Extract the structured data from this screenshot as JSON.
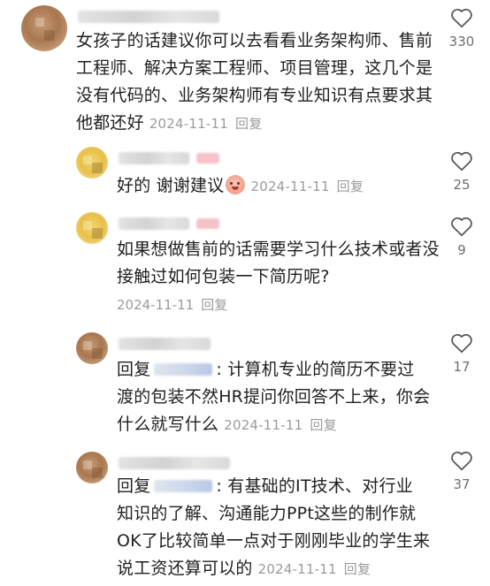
{
  "comments": [
    {
      "lines": [
        "女孩子的话建议你可以去看看业务架构师、售前",
        "工程师、解决方案工程师、项目管理，这几个是",
        "没有代码的、业务架构师有专业知识有点要求其",
        "他都还好"
      ],
      "date": "2024-11-11",
      "reply_label": "回复",
      "likes": "330",
      "heart_icon": "heart-outline-icon"
    },
    {
      "text": "好的 谢谢建议",
      "emoji_icon": "pig-face-emoji-icon",
      "date": "2024-11-11",
      "reply_label": "回复",
      "likes": "25"
    },
    {
      "lines": [
        "如果想做售前的话需要学习什么技术或者没",
        "接触过如何包装一下简历呢?"
      ],
      "date": "2024-11-11",
      "reply_label": "回复",
      "likes": "9"
    },
    {
      "reply_prefix": "回复",
      "lines": [
        ": 计算机专业的简历不要过",
        "渡的包装不然HR提问你回答不上来，你会",
        "什么就写什么"
      ],
      "date": "2024-11-11",
      "reply_label": "回复",
      "likes": "17"
    },
    {
      "reply_prefix": "回复",
      "lines": ": 有基础的IT技术、对行业",
      "lines_rest": [
        "知识的了解、沟通能力PPt这些的制作就",
        "OK了比较简单一点对于刚刚毕业的学生来",
        "说工资还算可以的"
      ],
      "date": "2024-11-11",
      "reply_label": "回复",
      "likes": "37"
    }
  ]
}
